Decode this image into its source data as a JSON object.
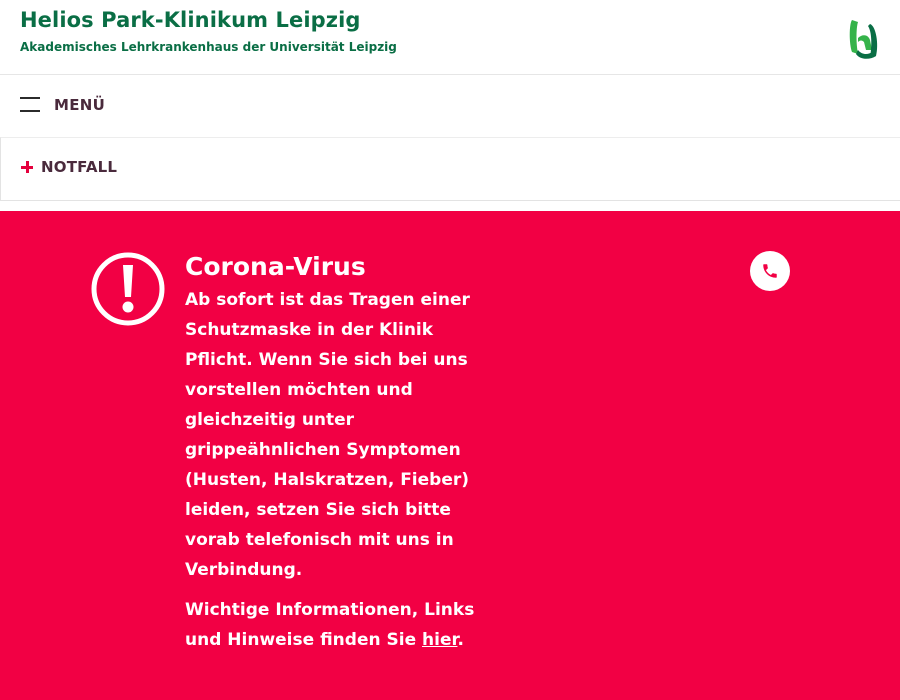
{
  "header": {
    "title": "Helios Park-Klinikum Leipzig",
    "subtitle": "Akademisches Lehrkrankenhaus der Universität Leipzig",
    "logo_icon": "helios-logo-icon",
    "brand_color": "#0a6e45"
  },
  "menu": {
    "label": "MENÜ",
    "icon": "hamburger-icon"
  },
  "emergency": {
    "label": "NOTFALL",
    "icon": "plus-icon",
    "accent_color": "#e5003d"
  },
  "alert": {
    "background_color": "#f20044",
    "icon": "exclamation-circle-icon",
    "title": "Corona-Virus",
    "message": "Ab sofort ist das Tragen einer Schutzmaske in der Klinik Pflicht. Wenn Sie sich bei uns vorstellen möchten und gleichzeitig unter grippeähnlichen Symptomen (Husten, Halskratzen, Fieber) leiden, setzen Sie sich bitte vorab telefonisch mit uns in Verbindung.",
    "info_prefix": "Wichtige Informationen, Links und Hinweise finden Sie ",
    "info_link": "hier",
    "info_suffix": ".",
    "phone_icon": "phone-icon"
  }
}
